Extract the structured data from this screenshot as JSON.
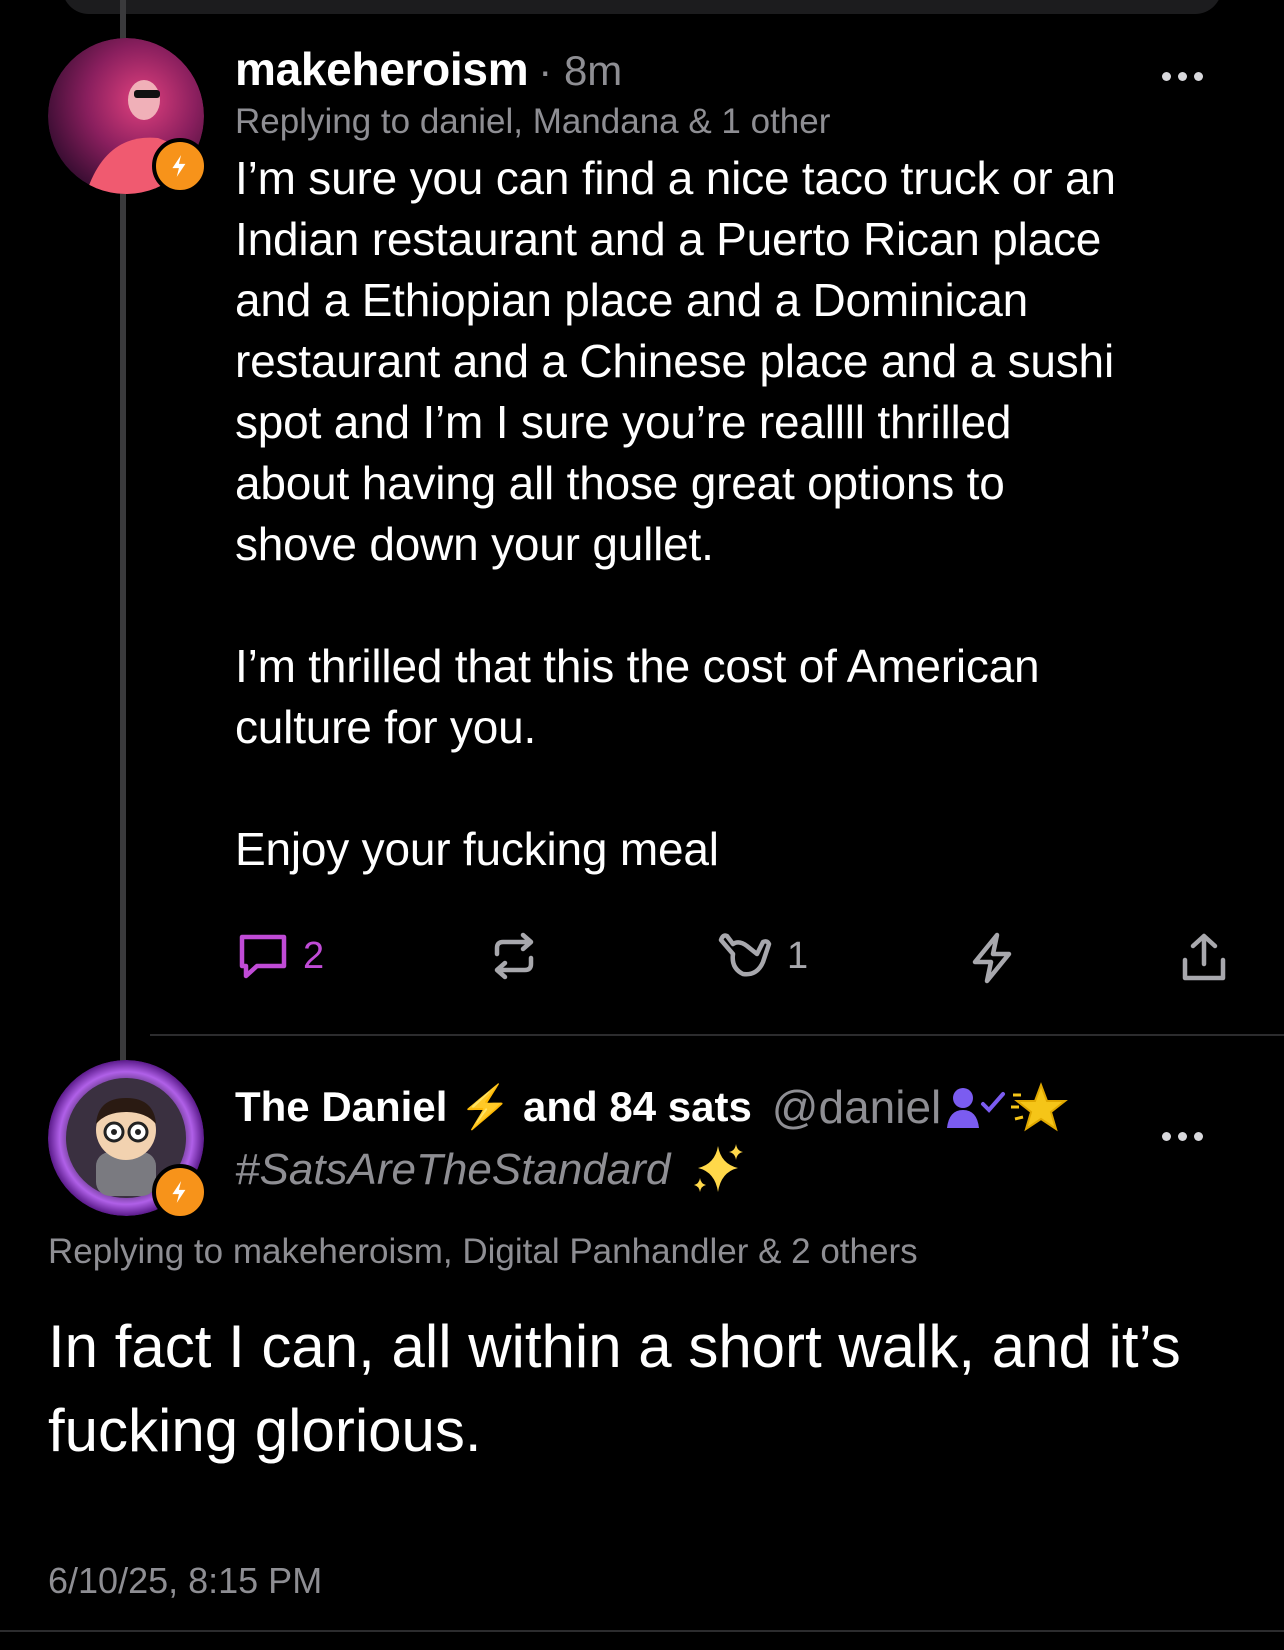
{
  "post1": {
    "author": "makeheroism",
    "time": "· 8m",
    "replying_to": "Replying to daniel, Mandana  & 1 other",
    "body": "I’m sure you can find a nice taco truck or an\nIndian restaurant and a Puerto Rican place\nand a Ethiopian place and a Dominican\nrestaurant and a Chinese place and a sushi\nspot and I’m I sure you’re reallll thrilled\nabout having all those great options to\nshove down your gullet.\n\nI’m thrilled that this the cost of American\nculture for you.\n\nEnjoy your fucking meal",
    "actions": {
      "reply_count": "2",
      "repost_count": "",
      "like_count": "1",
      "zap_count": ""
    }
  },
  "post2": {
    "display_name": "The Daniel ⚡️ and 84 sats",
    "handle": "@daniel",
    "hashtag": "#SatsAreTheStandard",
    "replying_to": "Replying to makeheroism, Digital Panhandler & 2 others",
    "body": "In fact I can, all within a short walk, and it’s\nfucking glorious.",
    "timestamp": "6/10/25, 8:15 PM"
  },
  "colors": {
    "background": "#000000",
    "accent_reply": "#c04bd6",
    "zap_badge": "#f7931a",
    "muted_text": "#8e8e93"
  },
  "icons": [
    "lightning-badge-icon",
    "more-dots-icon",
    "reply-icon",
    "repost-icon",
    "shaka-like-icon",
    "zap-icon",
    "share-icon",
    "verified-user-icon",
    "star-icon",
    "sparkles-icon"
  ]
}
